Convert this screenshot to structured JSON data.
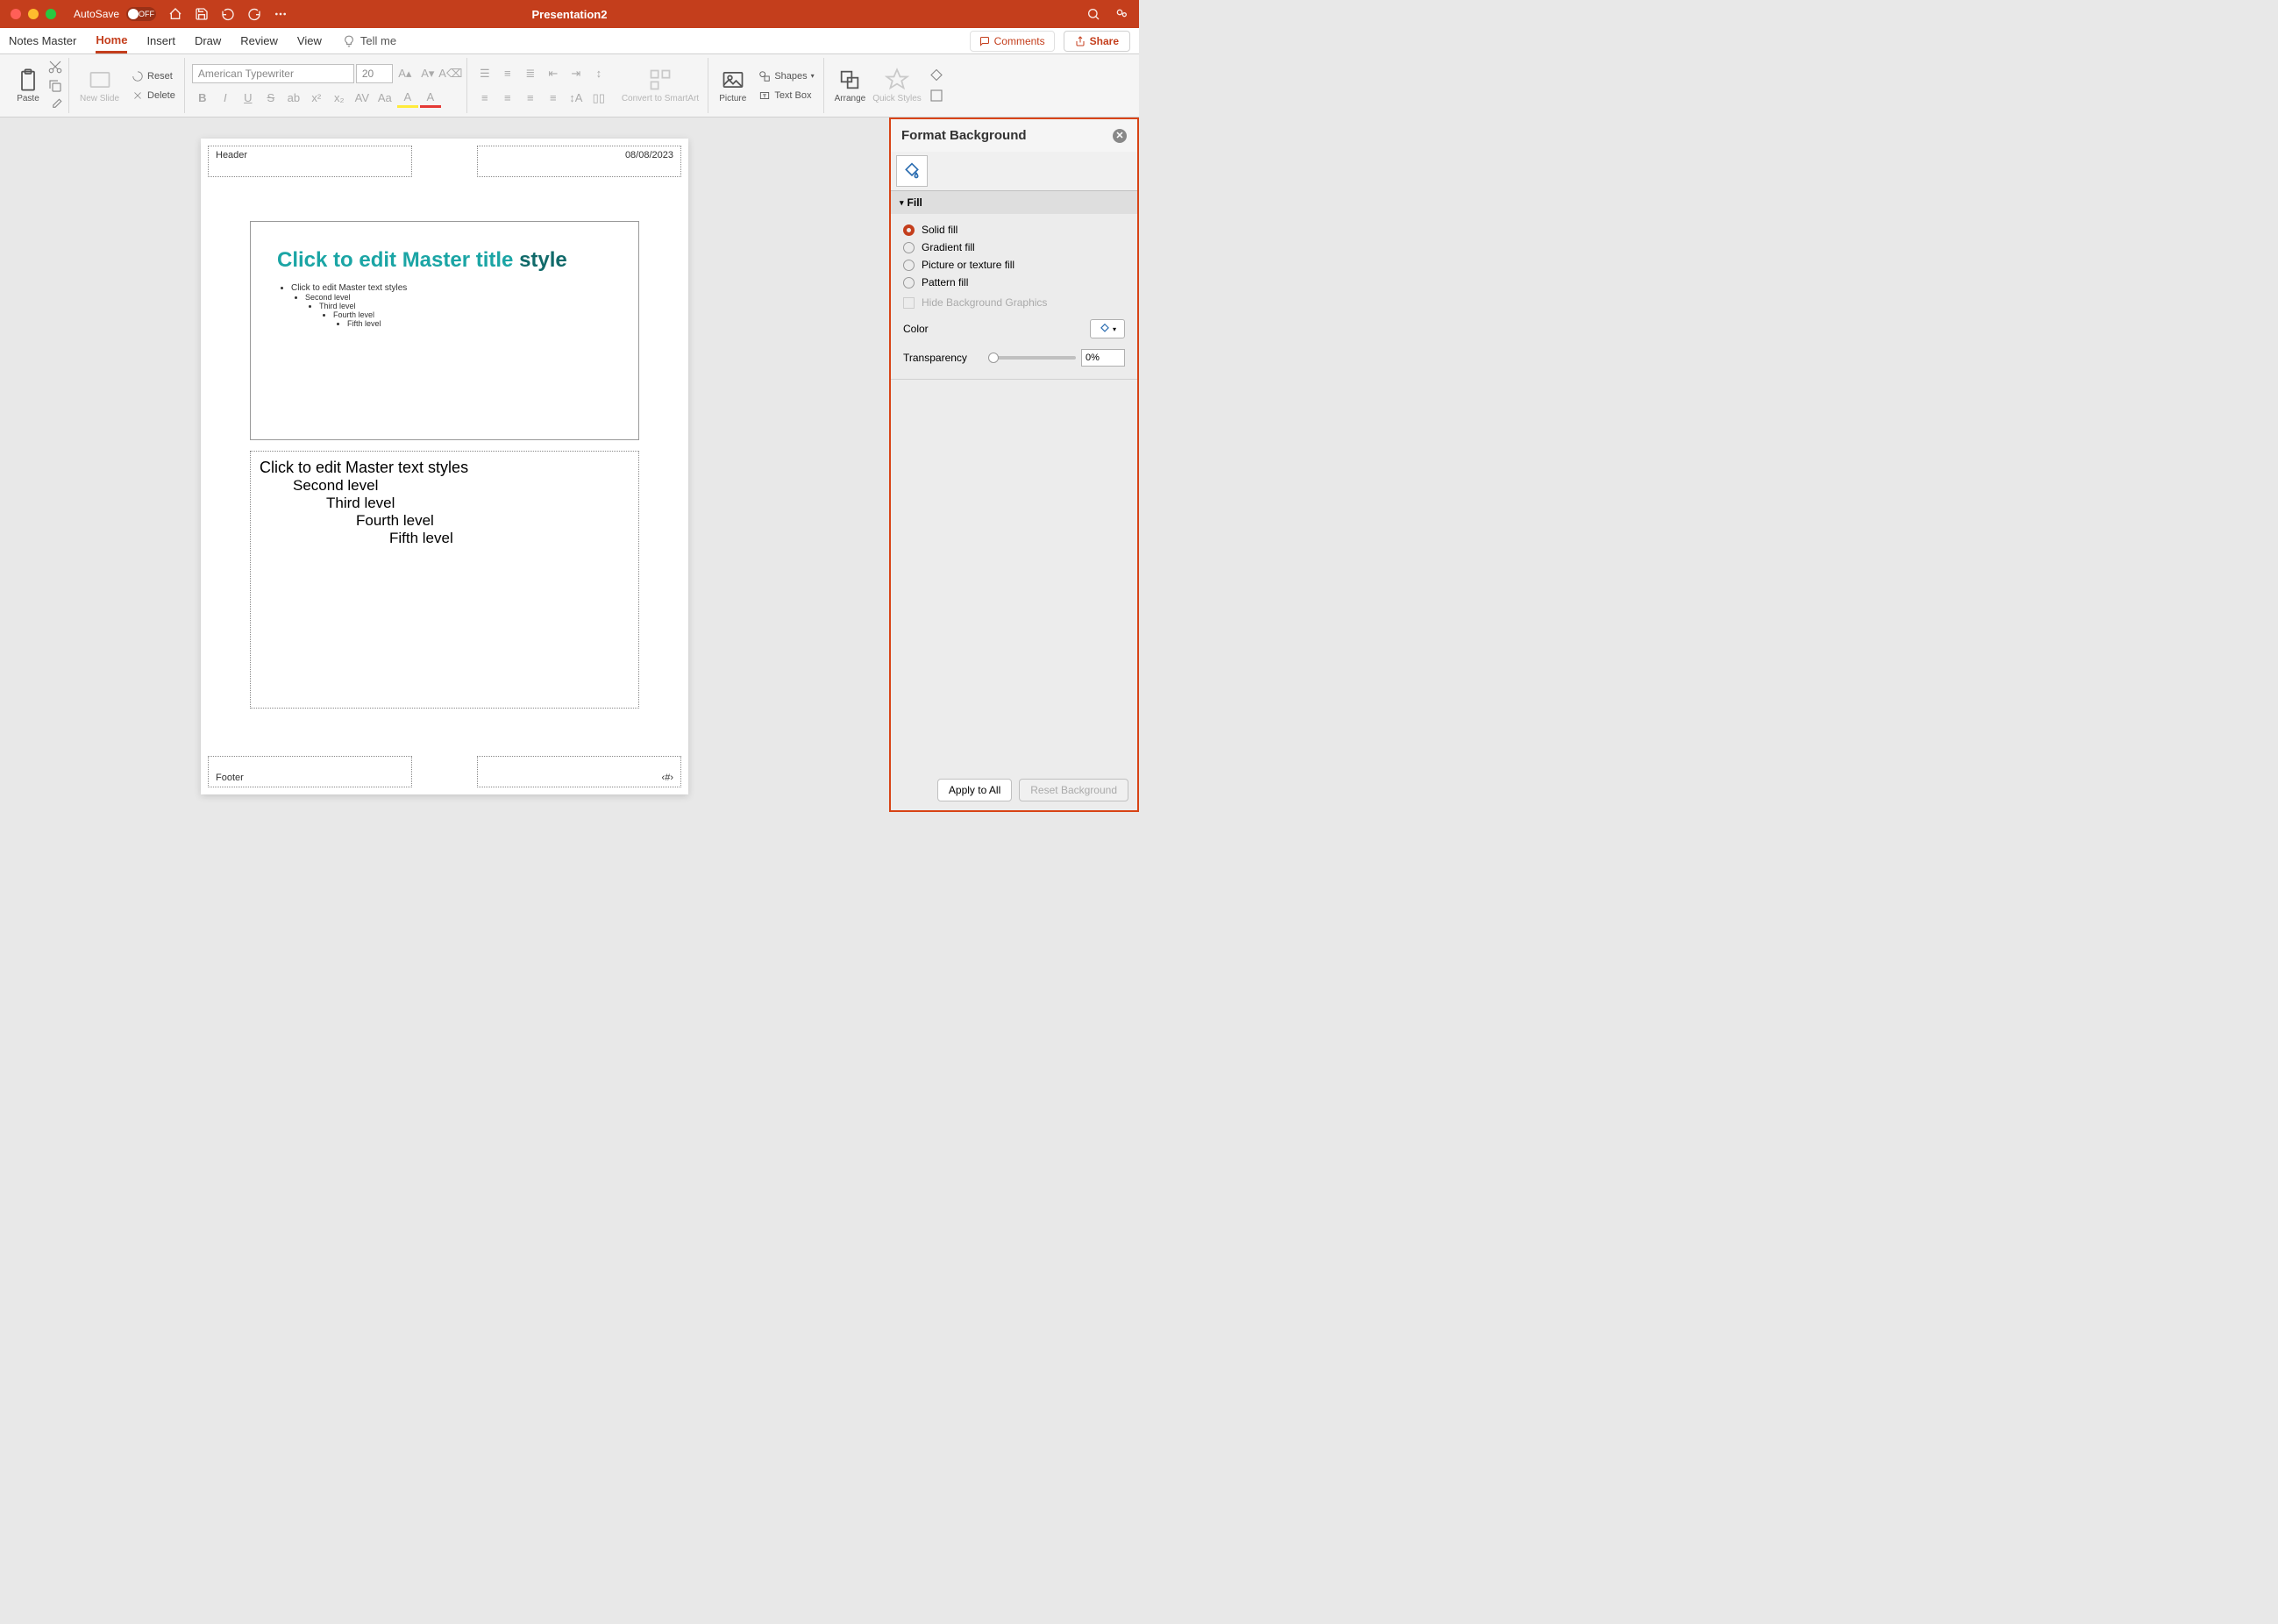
{
  "titlebar": {
    "autosave_label": "AutoSave",
    "autosave_state": "OFF",
    "document_title": "Presentation2"
  },
  "tabs": {
    "notes_master": "Notes Master",
    "home": "Home",
    "insert": "Insert",
    "draw": "Draw",
    "review": "Review",
    "view": "View",
    "tellme": "Tell me",
    "comments": "Comments",
    "share": "Share"
  },
  "ribbon": {
    "paste": "Paste",
    "new_slide": "New Slide",
    "reset": "Reset",
    "delete": "Delete",
    "font_name": "American Typewriter",
    "font_size": "20",
    "convert_smartart": "Convert to SmartArt",
    "picture": "Picture",
    "shapes": "Shapes",
    "text_box": "Text Box",
    "arrange": "Arrange",
    "quick_styles": "Quick Styles"
  },
  "page": {
    "header": "Header",
    "date": "08/08/2023",
    "footer": "Footer",
    "pagenum": "‹#›",
    "slide_title_main": "Click to edit Master title ",
    "slide_title_accent": "style",
    "slide_bullets": {
      "l1": "Click to edit Master text styles",
      "l2": "Second level",
      "l3": "Third level",
      "l4": "Fourth level",
      "l5": "Fifth level"
    },
    "notes": {
      "l1": "Click to edit Master text styles",
      "l2": "Second level",
      "l3": "Third level",
      "l4": "Fourth level",
      "l5": "Fifth level"
    }
  },
  "pane": {
    "title": "Format Background",
    "section_fill": "Fill",
    "solid_fill": "Solid fill",
    "gradient_fill": "Gradient fill",
    "picture_fill": "Picture or texture fill",
    "pattern_fill": "Pattern fill",
    "hide_bg": "Hide Background Graphics",
    "color_label": "Color",
    "transparency_label": "Transparency",
    "transparency_value": "0%",
    "apply_all": "Apply to All",
    "reset_bg": "Reset Background"
  }
}
